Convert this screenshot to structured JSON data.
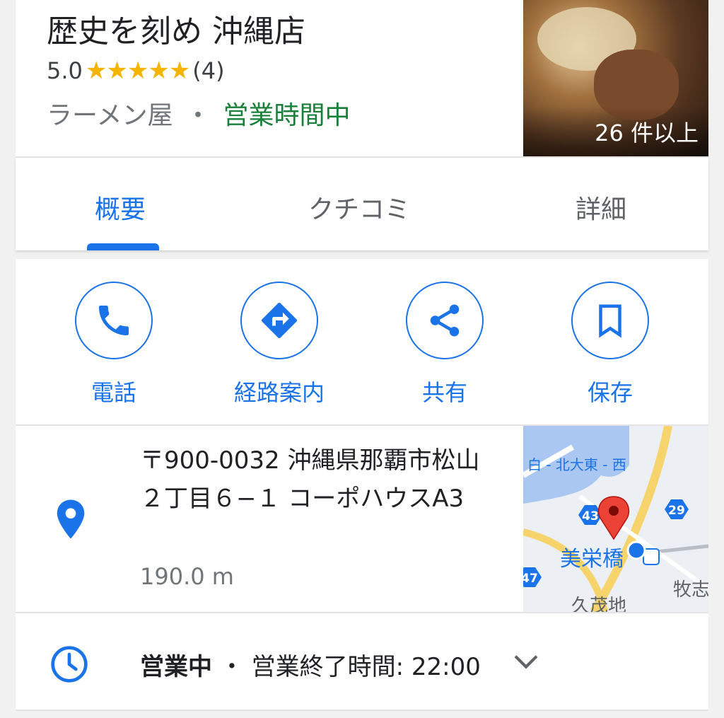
{
  "place": {
    "name": "歴史を刻め 沖縄店",
    "rating": "5.0",
    "stars": "★★★★★",
    "review_count": "(4)",
    "category": "ラーメン屋",
    "separator": "・",
    "open_status": "営業時間中",
    "photo_count": "26 件以上"
  },
  "tabs": [
    {
      "label": "概要",
      "active": true
    },
    {
      "label": "クチコミ",
      "active": false
    },
    {
      "label": "詳細",
      "active": false
    }
  ],
  "actions": [
    {
      "label": "電話",
      "icon": "phone-icon"
    },
    {
      "label": "経路案内",
      "icon": "directions-icon"
    },
    {
      "label": "共有",
      "icon": "share-icon"
    },
    {
      "label": "保存",
      "icon": "bookmark-icon"
    }
  ],
  "address": {
    "text": "〒900-0032 沖縄県那覇市松山２丁目６−１ コーポハウスA3",
    "distance": "190.0 m",
    "map": {
      "road_label": "白 - 北大東 - 西",
      "route_a": "43",
      "route_b": "29",
      "route_c": "47",
      "station": "美栄橋",
      "area_a": "牧志",
      "area_b": "久茂地"
    }
  },
  "hours": {
    "status": "営業中",
    "dot": "・",
    "closing": "営業終了時間: 22:00"
  },
  "colors": {
    "accent": "#1a73e8",
    "open_green": "#188038",
    "star": "#f4b400",
    "pin_red": "#ea4335"
  }
}
